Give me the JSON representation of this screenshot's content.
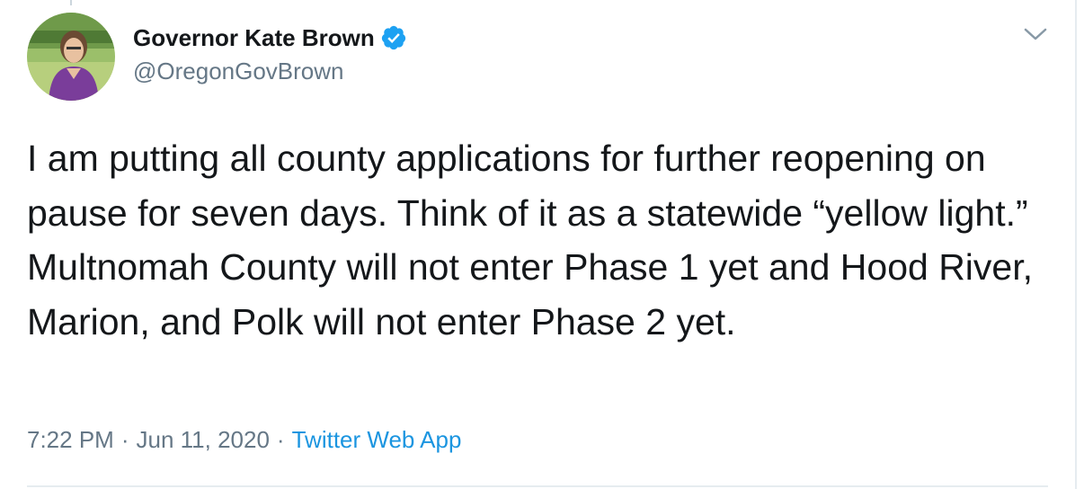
{
  "author": {
    "display_name": "Governor Kate Brown",
    "handle": "@OregonGovBrown",
    "verified_icon": "verified-badge-icon",
    "avatar_icon": "avatar-photo"
  },
  "tweet": {
    "text": "I am putting all county applications for further reopening on pause for seven days. Think of it as a statewide “yellow light.” Multnomah County will not enter Phase 1 yet and Hood River, Marion, and Polk will not enter Phase 2 yet.",
    "time": "7:22 PM",
    "separator": "·",
    "date": "Jun 11, 2020",
    "source": "Twitter Web App"
  },
  "menu": {
    "icon": "chevron-down-icon"
  },
  "colors": {
    "text": "#14171a",
    "secondary": "#657786",
    "link": "#1b95e0",
    "verified": "#1da1f2",
    "divider": "#e6ecf0"
  }
}
